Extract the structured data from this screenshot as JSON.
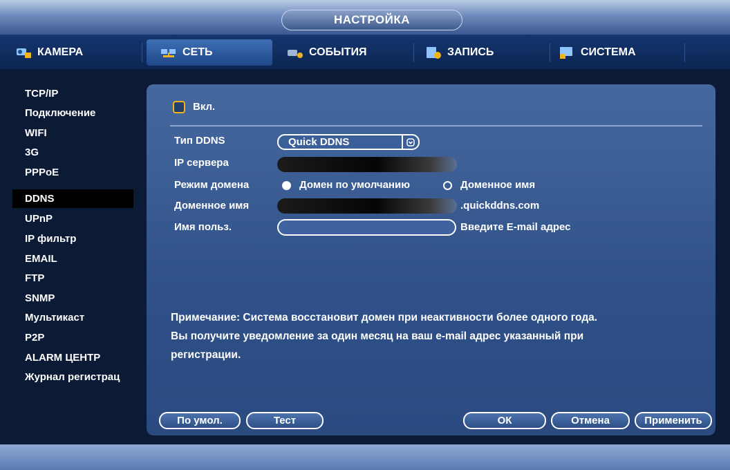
{
  "window": {
    "title": "НАСТРОЙКА"
  },
  "tabs": [
    {
      "label": "КАМЕРА",
      "icon": "camera-icon"
    },
    {
      "label": "СЕТЬ",
      "icon": "network-icon",
      "active": true
    },
    {
      "label": "СОБЫТИЯ",
      "icon": "events-icon"
    },
    {
      "label": "ЗАПИСЬ",
      "icon": "record-icon"
    },
    {
      "label": "СИСТЕМА",
      "icon": "system-icon"
    }
  ],
  "sidebar": {
    "selected": "DDNS",
    "items": [
      "TCP/IP",
      "Подключение",
      "WIFI",
      "3G",
      "PPPoE",
      "DDNS",
      "UPnP",
      "IP фильтр",
      "EMAIL",
      "FTP",
      "SNMP",
      "Мультикаст",
      "P2P",
      "ALARM ЦЕНТР",
      "Журнал регистрац"
    ]
  },
  "ddns": {
    "enable_label": "Вкл.",
    "enabled": false,
    "type_label": "Тип DDNS",
    "type_value": "Quick DDNS",
    "server_ip_label": "IP сервера",
    "domain_mode_label": "Режим домена",
    "domain_mode_default": "Домен по умолчанию",
    "domain_mode_custom": "Доменное имя",
    "domain_mode_selected": "default",
    "domain_name_label": "Доменное имя",
    "domain_suffix": ".quickddns.com",
    "username_label": "Имя польз.",
    "username_value": "",
    "username_hint": "Введите E-mail адрес",
    "note_line1": "Примечание: Система восстановит домен при неактивности более одного года.",
    "note_line2": "Вы получите уведомление за один месяц на ваш e-mail адрес указанный при",
    "note_line3": "регистрации."
  },
  "buttons": {
    "default": "По умол.",
    "test": "Тест",
    "ok": "ОК",
    "cancel": "Отмена",
    "apply": "Применить"
  },
  "colors": {
    "accent": "#f2b31a",
    "panel": "#3a5f9b",
    "background": "#0b1a35"
  }
}
